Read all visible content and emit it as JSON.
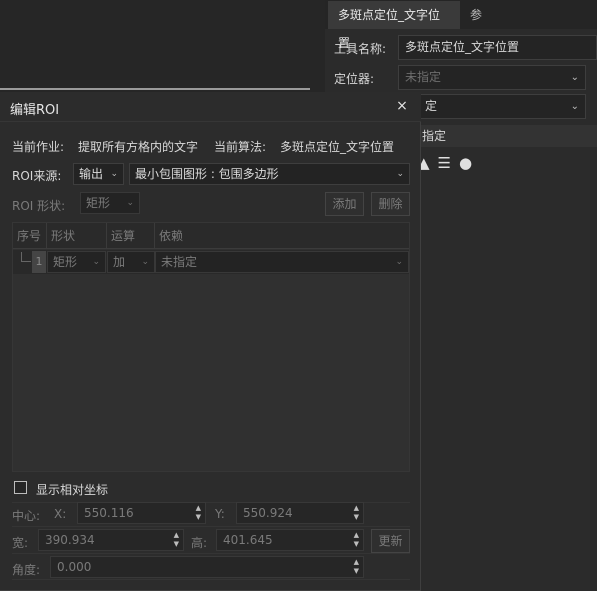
{
  "background_panel": {
    "tabs": [
      {
        "label": "多斑点定位_文字位置",
        "active": true
      },
      {
        "label": "参数",
        "active": false
      }
    ],
    "tool_name_label": "工具名称:",
    "tool_name_value": "多斑点定位_文字位置",
    "locator_label": "定位器:",
    "locator_value": "未指定",
    "second_select_value": "定",
    "section_label": "指定",
    "icons": [
      "shapes-icon",
      "list-icon",
      "palette-icon"
    ]
  },
  "dialog": {
    "title": "编辑ROI",
    "close_label": "×",
    "current_job_label": "当前作业:",
    "current_job_value": "提取所有方格内的文字",
    "current_algo_label": "当前算法:",
    "current_algo_value": "多斑点定位_文字位置",
    "roi_source_label": "ROI来源:",
    "roi_source_value": "输出",
    "roi_output_value": "最小包围图形 : 包围多边形",
    "roi_shape_label": "ROI 形状:",
    "roi_shape_value": "矩形",
    "add_label": "添加",
    "delete_label": "删除",
    "table": {
      "columns": [
        "序号",
        "形状",
        "运算",
        "依赖"
      ],
      "rows": [
        {
          "index": "1",
          "shape": "矩形",
          "op": "加",
          "dep": "未指定"
        }
      ]
    },
    "show_relative_label": "显示相对坐标",
    "center_label": "中心:",
    "x_label": "X:",
    "x_value": "550.116",
    "y_label": "Y:",
    "y_value": "550.924",
    "width_label": "宽:",
    "width_value": "390.934",
    "height_label": "高:",
    "height_value": "401.645",
    "update_label": "更新",
    "angle_label": "角度:",
    "angle_value": "0.000"
  }
}
